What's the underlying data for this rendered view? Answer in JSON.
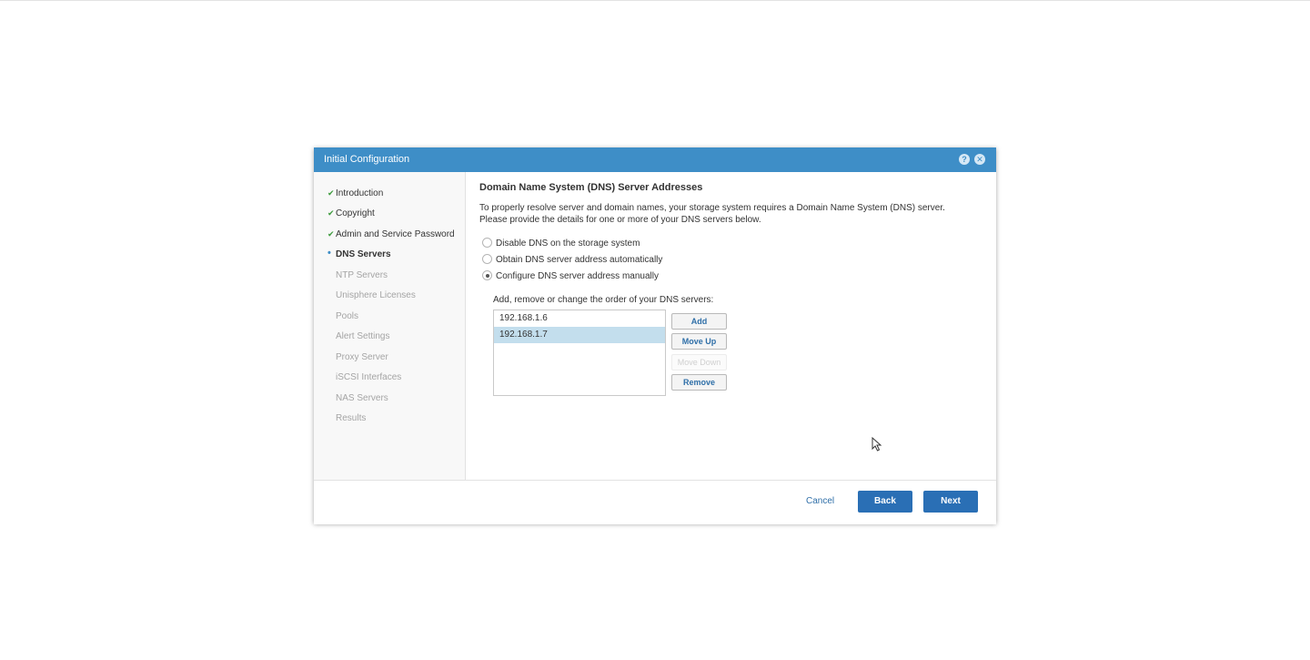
{
  "dialog": {
    "title": "Initial Configuration",
    "help_icon": "question-mark",
    "close_icon": "x"
  },
  "sidebar": {
    "items": [
      {
        "label": "Introduction",
        "state": "done"
      },
      {
        "label": "Copyright",
        "state": "done"
      },
      {
        "label": "Admin and Service Password",
        "state": "done"
      },
      {
        "label": "DNS Servers",
        "state": "current"
      },
      {
        "label": "NTP Servers",
        "state": "pending"
      },
      {
        "label": "Unisphere Licenses",
        "state": "pending"
      },
      {
        "label": "Pools",
        "state": "pending"
      },
      {
        "label": "Alert Settings",
        "state": "pending"
      },
      {
        "label": "Proxy Server",
        "state": "pending"
      },
      {
        "label": "iSCSI Interfaces",
        "state": "pending"
      },
      {
        "label": "NAS Servers",
        "state": "pending"
      },
      {
        "label": "Results",
        "state": "pending"
      }
    ]
  },
  "content": {
    "heading": "Domain Name System (DNS) Server Addresses",
    "description": "To properly resolve server and domain names, your storage system requires a Domain Name System (DNS) server. Please provide the details for one or more of your DNS servers below.",
    "options": [
      {
        "label": "Disable DNS on the storage system",
        "checked": false
      },
      {
        "label": "Obtain DNS server address automatically",
        "checked": false
      },
      {
        "label": "Configure DNS server address manually",
        "checked": true
      }
    ],
    "list_label": "Add, remove or change the order of your DNS servers:",
    "dns_servers": [
      "192.168.1.6",
      "192.168.1.7"
    ],
    "selected_server": "192.168.1.7",
    "buttons": {
      "add": "Add",
      "move_up": "Move Up",
      "move_down": "Move Down",
      "remove": "Remove"
    }
  },
  "footer": {
    "cancel": "Cancel",
    "back": "Back",
    "next": "Next"
  },
  "colors": {
    "titlebar": "#3e8ec7",
    "primary_button": "#2a6fb5",
    "selection": "#c3deed",
    "check": "#3c9a3c"
  }
}
